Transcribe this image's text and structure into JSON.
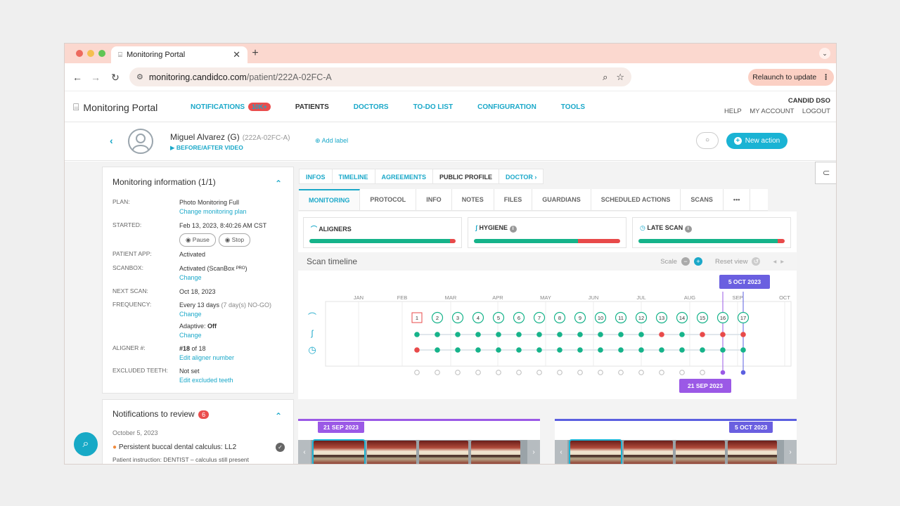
{
  "browser": {
    "tab_title": "Monitoring Portal",
    "url_host": "monitoring.candidco.com",
    "url_path": "/patient/222A-02FC-A",
    "relaunch_label": "Relaunch to update"
  },
  "app": {
    "brand": "Monitoring Portal",
    "nav": [
      {
        "label": "NOTIFICATIONS",
        "badge": "10K+"
      },
      {
        "label": "PATIENTS"
      },
      {
        "label": "DOCTORS"
      },
      {
        "label": "TO-DO LIST"
      },
      {
        "label": "CONFIGURATION"
      },
      {
        "label": "TOOLS"
      }
    ],
    "account_org": "CANDID DSO",
    "help": "HELP",
    "my_account": "MY ACCOUNT",
    "logout": "LOGOUT"
  },
  "patient": {
    "name": "Miguel Alvarez (G)",
    "id": "(222A-02FC-A)",
    "before_after": "▶ BEFORE/AFTER VIDEO",
    "add_label": "Add label",
    "new_action": "New action"
  },
  "monitoring_info": {
    "title": "Monitoring information (1/1)",
    "plan_k": "PLAN:",
    "plan_v": "Photo Monitoring Full",
    "plan_link": "Change monitoring plan",
    "started_k": "STARTED:",
    "started_v": "Feb 13, 2023, 8:40:26 AM CST",
    "pause": "Pause",
    "stop": "Stop",
    "app_k": "PATIENT APP:",
    "app_v": "Activated",
    "scanbox_k": "SCANBOX:",
    "scanbox_v": "Activated (ScanBox ᴾᴿᴼ)",
    "scanbox_link": "Change",
    "next_k": "NEXT SCAN:",
    "next_v": "Oct 18, 2023",
    "freq_k": "FREQUENCY:",
    "freq_v": "Every 13 days",
    "freq_note": "(7 day(s) NO-GO)",
    "freq_link": "Change",
    "adaptive_label": "Adaptive:",
    "adaptive_value": "Off",
    "adaptive_link": "Change",
    "aligner_k": "ALIGNER #:",
    "aligner_v": "#18",
    "aligner_of": "of 18",
    "aligner_link": "Edit aligner number",
    "teeth_k": "EXCLUDED TEETH:",
    "teeth_v": "Not set",
    "teeth_link": "Edit excluded teeth"
  },
  "notifications": {
    "title": "Notifications to review",
    "count": "6",
    "date": "October 5, 2023",
    "item": "Persistent buccal dental calculus: LL2",
    "instruction": "Patient instruction: DENTIST – calculus still present"
  },
  "tabs_top": [
    "INFOS",
    "TIMELINE",
    "AGREEMENTS",
    "PUBLIC PROFILE",
    "DOCTOR ›"
  ],
  "tabs_sub": [
    "MONITORING",
    "PROTOCOL",
    "INFO",
    "NOTES",
    "FILES",
    "GUARDIANS",
    "SCHEDULED ACTIONS",
    "SCANS",
    "•••"
  ],
  "metrics": [
    {
      "label": "ALIGNERS",
      "green": 0.96,
      "red": 0.04
    },
    {
      "label": "HYGIENE",
      "green": 0.71,
      "red": 0.29
    },
    {
      "label": "LATE SCAN",
      "green": 0.95,
      "red": 0.05
    }
  ],
  "scan_timeline": {
    "title": "Scan timeline",
    "scale": "Scale",
    "reset": "Reset view",
    "months": [
      "JAN",
      "FEB",
      "MAR",
      "APR",
      "MAY",
      "JUN",
      "JUL",
      "AUG",
      "SEP",
      "OCT"
    ],
    "scans": [
      "1",
      "2",
      "3",
      "4",
      "5",
      "6",
      "7",
      "8",
      "9",
      "10",
      "11",
      "12",
      "13",
      "14",
      "15",
      "16",
      "17"
    ],
    "aligner_row": [
      "g",
      "g",
      "g",
      "g",
      "g",
      "g",
      "g",
      "g",
      "g",
      "g",
      "g",
      "g",
      "r",
      "g",
      "r",
      "r",
      "r"
    ],
    "hygiene_row": [
      "r",
      "g",
      "g",
      "g",
      "g",
      "g",
      "g",
      "g",
      "g",
      "g",
      "g",
      "g",
      "g",
      "g",
      "g",
      "g",
      "g"
    ],
    "selected_top": "5 OCT 2023",
    "selected_bottom": "21 SEP 2023"
  },
  "thumbs": {
    "left_date": "21 SEP 2023",
    "right_date": "5 OCT 2023"
  },
  "colors": {
    "accent": "#1aa8c9",
    "green": "#16b38a",
    "red": "#e84a4a",
    "purple": "#9b59e6"
  }
}
